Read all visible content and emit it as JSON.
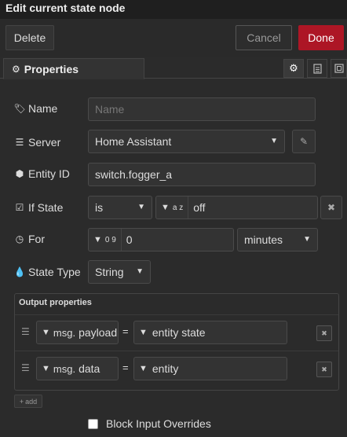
{
  "window": {
    "title": "Edit current state node"
  },
  "toolbar": {
    "delete_label": "Delete",
    "cancel_label": "Cancel",
    "done_label": "Done"
  },
  "tabs": {
    "properties_label": "Properties"
  },
  "form": {
    "name_label": "Name",
    "name_placeholder": "Name",
    "server_label": "Server",
    "server_value": "Home Assistant",
    "entity_label": "Entity ID",
    "entity_value": "switch.fogger_a",
    "ifstate_label": "If State",
    "ifstate_operator": "is",
    "ifstate_type_glyph": "a z",
    "ifstate_value": "off",
    "for_label": "For",
    "for_type_glyph": "0 9",
    "for_value": "0",
    "for_unit": "minutes",
    "statetype_label": "State Type",
    "statetype_value": "String"
  },
  "output": {
    "title": "Output properties",
    "rows": [
      {
        "prefix": "msg.",
        "property": "payload",
        "eq": "=",
        "value": "entity state"
      },
      {
        "prefix": "msg.",
        "property": "data",
        "eq": "=",
        "value": "entity"
      }
    ],
    "add_label": "add"
  },
  "block_input": {
    "label": "Block Input Overrides"
  },
  "colors": {
    "done": "#ad1625",
    "background": "#2b2b2b"
  }
}
